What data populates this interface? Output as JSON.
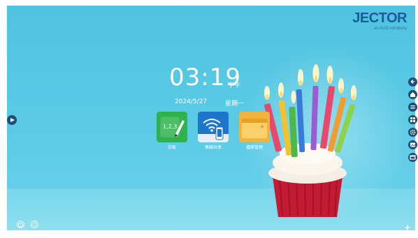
{
  "brand": {
    "logo": "JECTOR",
    "tagline": "an AUO company"
  },
  "clock": {
    "time": "03:19",
    "ampm": "下午",
    "date": "2024/5/27",
    "weekday": "星期一"
  },
  "apps": [
    {
      "label": "白板",
      "icon": "whiteboard-icon",
      "color": "#2eb24b"
    },
    {
      "label": "無線共享",
      "icon": "wireless-share-icon",
      "color": "#1d76c9"
    },
    {
      "label": "檔案管理",
      "icon": "folder-icon",
      "color": "#f0b33b"
    }
  ],
  "sidebar": {
    "items": [
      "back-icon",
      "home-icon",
      "menu-icon",
      "apps-icon",
      "settings-icon",
      "image-icon",
      "window-icon"
    ]
  },
  "colors": {
    "background": "#5bcbe5",
    "button": "#1f4f78"
  }
}
